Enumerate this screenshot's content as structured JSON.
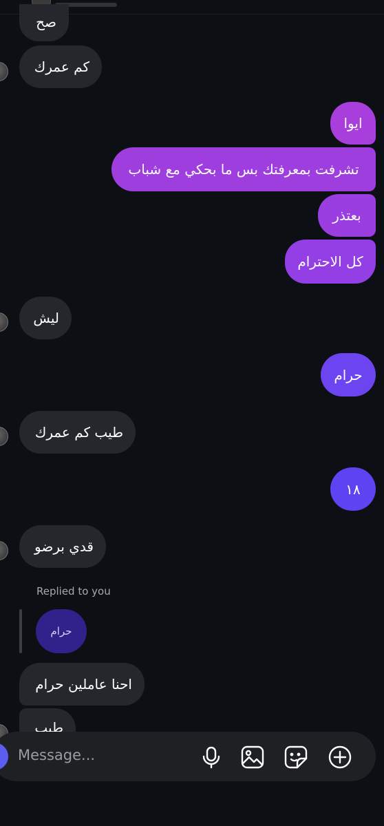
{
  "messages": [
    {
      "text": "صح",
      "dir": "in"
    },
    {
      "text": "كم عمرك",
      "dir": "in"
    },
    {
      "text": "ايوا",
      "dir": "out"
    },
    {
      "text": "تشرفت بمعرفتك بس ما بحكي مع شباب",
      "dir": "out"
    },
    {
      "text": "بعتذر",
      "dir": "out"
    },
    {
      "text": "كل الاحترام",
      "dir": "out"
    },
    {
      "text": "ليش",
      "dir": "in"
    },
    {
      "text": "حرام",
      "dir": "out"
    },
    {
      "text": "طيب كم عمرك",
      "dir": "in"
    },
    {
      "text": "١٨",
      "dir": "out"
    },
    {
      "text": "قدي برضو",
      "dir": "in"
    },
    {
      "text": "احنا عاملين حرام",
      "dir": "in"
    },
    {
      "text": "طيب",
      "dir": "in"
    }
  ],
  "reply": {
    "label": "Replied to you",
    "quoted": "حرام"
  },
  "composer": {
    "placeholder": "Message..."
  },
  "icons": [
    "microphone-icon",
    "image-icon",
    "sticker-icon",
    "add-icon"
  ],
  "colors": {
    "background": "#0c0f14",
    "incoming": "#25272c",
    "outgoing_gradient": [
      "#a43fd8",
      "#8a3df0",
      "#6c44f0",
      "#5a43f2"
    ],
    "reply_bubble": "#31218a"
  }
}
